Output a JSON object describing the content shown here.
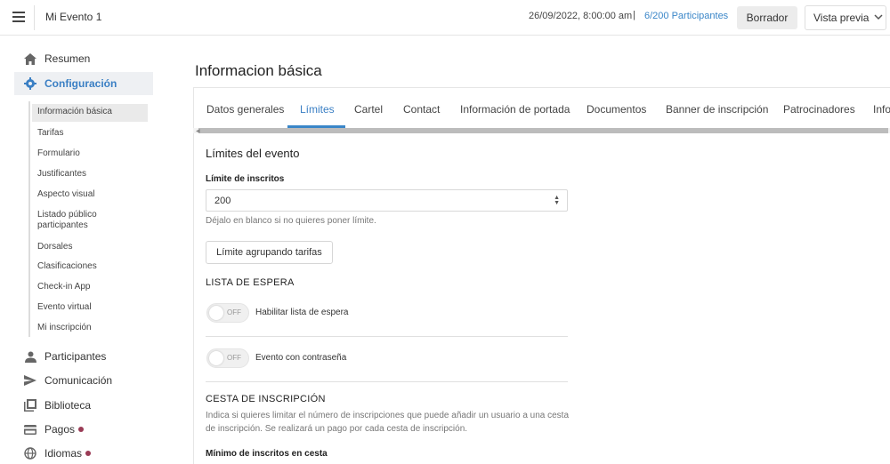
{
  "header": {
    "event_title": "Mi Evento 1",
    "datetime": "26/09/2022, 8:00:00 am",
    "separator": "|",
    "participants_count": "6/200",
    "participants_label": "Participantes",
    "status_button": "Borrador",
    "preview_button": "Vista previa"
  },
  "sidebar": {
    "items": [
      {
        "label": "Resumen",
        "icon": "home-icon"
      },
      {
        "label": "Configuración",
        "icon": "gear-icon"
      },
      {
        "label": "Participantes",
        "icon": "person-icon"
      },
      {
        "label": "Comunicación",
        "icon": "send-icon"
      },
      {
        "label": "Biblioteca",
        "icon": "library-icon"
      },
      {
        "label": "Pagos",
        "icon": "payments-icon"
      },
      {
        "label": "Idiomas",
        "icon": "globe-icon"
      }
    ],
    "sub_items": [
      "Información básica",
      "Tarifas",
      "Formulario",
      "Justificantes",
      "Aspecto visual",
      "Listado público participantes",
      "Dorsales",
      "Clasificaciones",
      "Check-in App",
      "Evento virtual",
      "Mi inscripción"
    ]
  },
  "main": {
    "page_title": "Informacion básica",
    "tabs": [
      "Datos generales",
      "Límites",
      "Cartel",
      "Contact",
      "Información de portada",
      "Documentos",
      "Banner de inscripción",
      "Patrocinadores",
      "Info"
    ],
    "section_title": "Límites del evento",
    "limit_label": "Límite de inscritos",
    "limit_value": "200",
    "limit_help": "Déjalo en blanco si no quieres poner límite.",
    "group_button": "Límite agrupando tarifas",
    "waitlist_heading": "LISTA DE ESPERA",
    "toggle_off_text": "OFF",
    "waitlist_toggle_label": "Habilitar lista de espera",
    "password_toggle_label": "Evento con contraseña",
    "cart_heading": "CESTA DE INSCRIPCIÓN",
    "cart_help_line1": "Indica si quieres limitar el número de inscripciones que puede añadir un usuario a una cesta",
    "cart_help_line2": "de inscripción. Se realizará un pago por cada cesta de inscripción.",
    "min_cart_label": "Mínimo de inscritos en cesta"
  },
  "colors": {
    "accent": "#3a86c8",
    "alert_dot": "#9a3b55"
  }
}
